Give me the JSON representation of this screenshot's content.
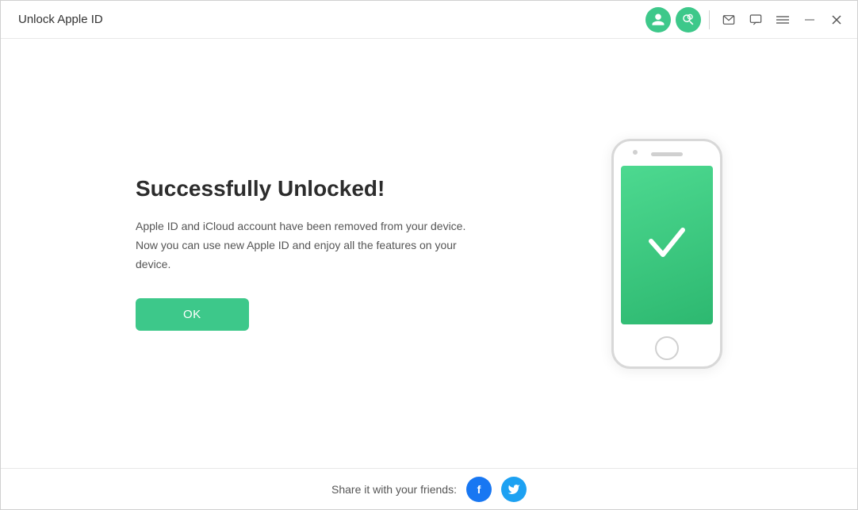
{
  "titleBar": {
    "appTitle": "Unlock Apple ID",
    "homeIconColor": "#3dc88a"
  },
  "main": {
    "successTitle": "Successfully Unlocked!",
    "successDesc1": "Apple ID and iCloud account have been removed from your device.",
    "successDesc2": "Now you can use new Apple ID and enjoy all the features on your device.",
    "okButton": "OK"
  },
  "footer": {
    "shareText": "Share it with your friends:",
    "facebookLabel": "f",
    "twitterLabel": "t"
  },
  "icons": {
    "home": "home-icon",
    "user": "user-icon",
    "search": "search-icon",
    "mail": "mail-icon",
    "message": "message-icon",
    "menu": "menu-icon",
    "minimize": "minimize-icon",
    "close": "close-icon"
  }
}
